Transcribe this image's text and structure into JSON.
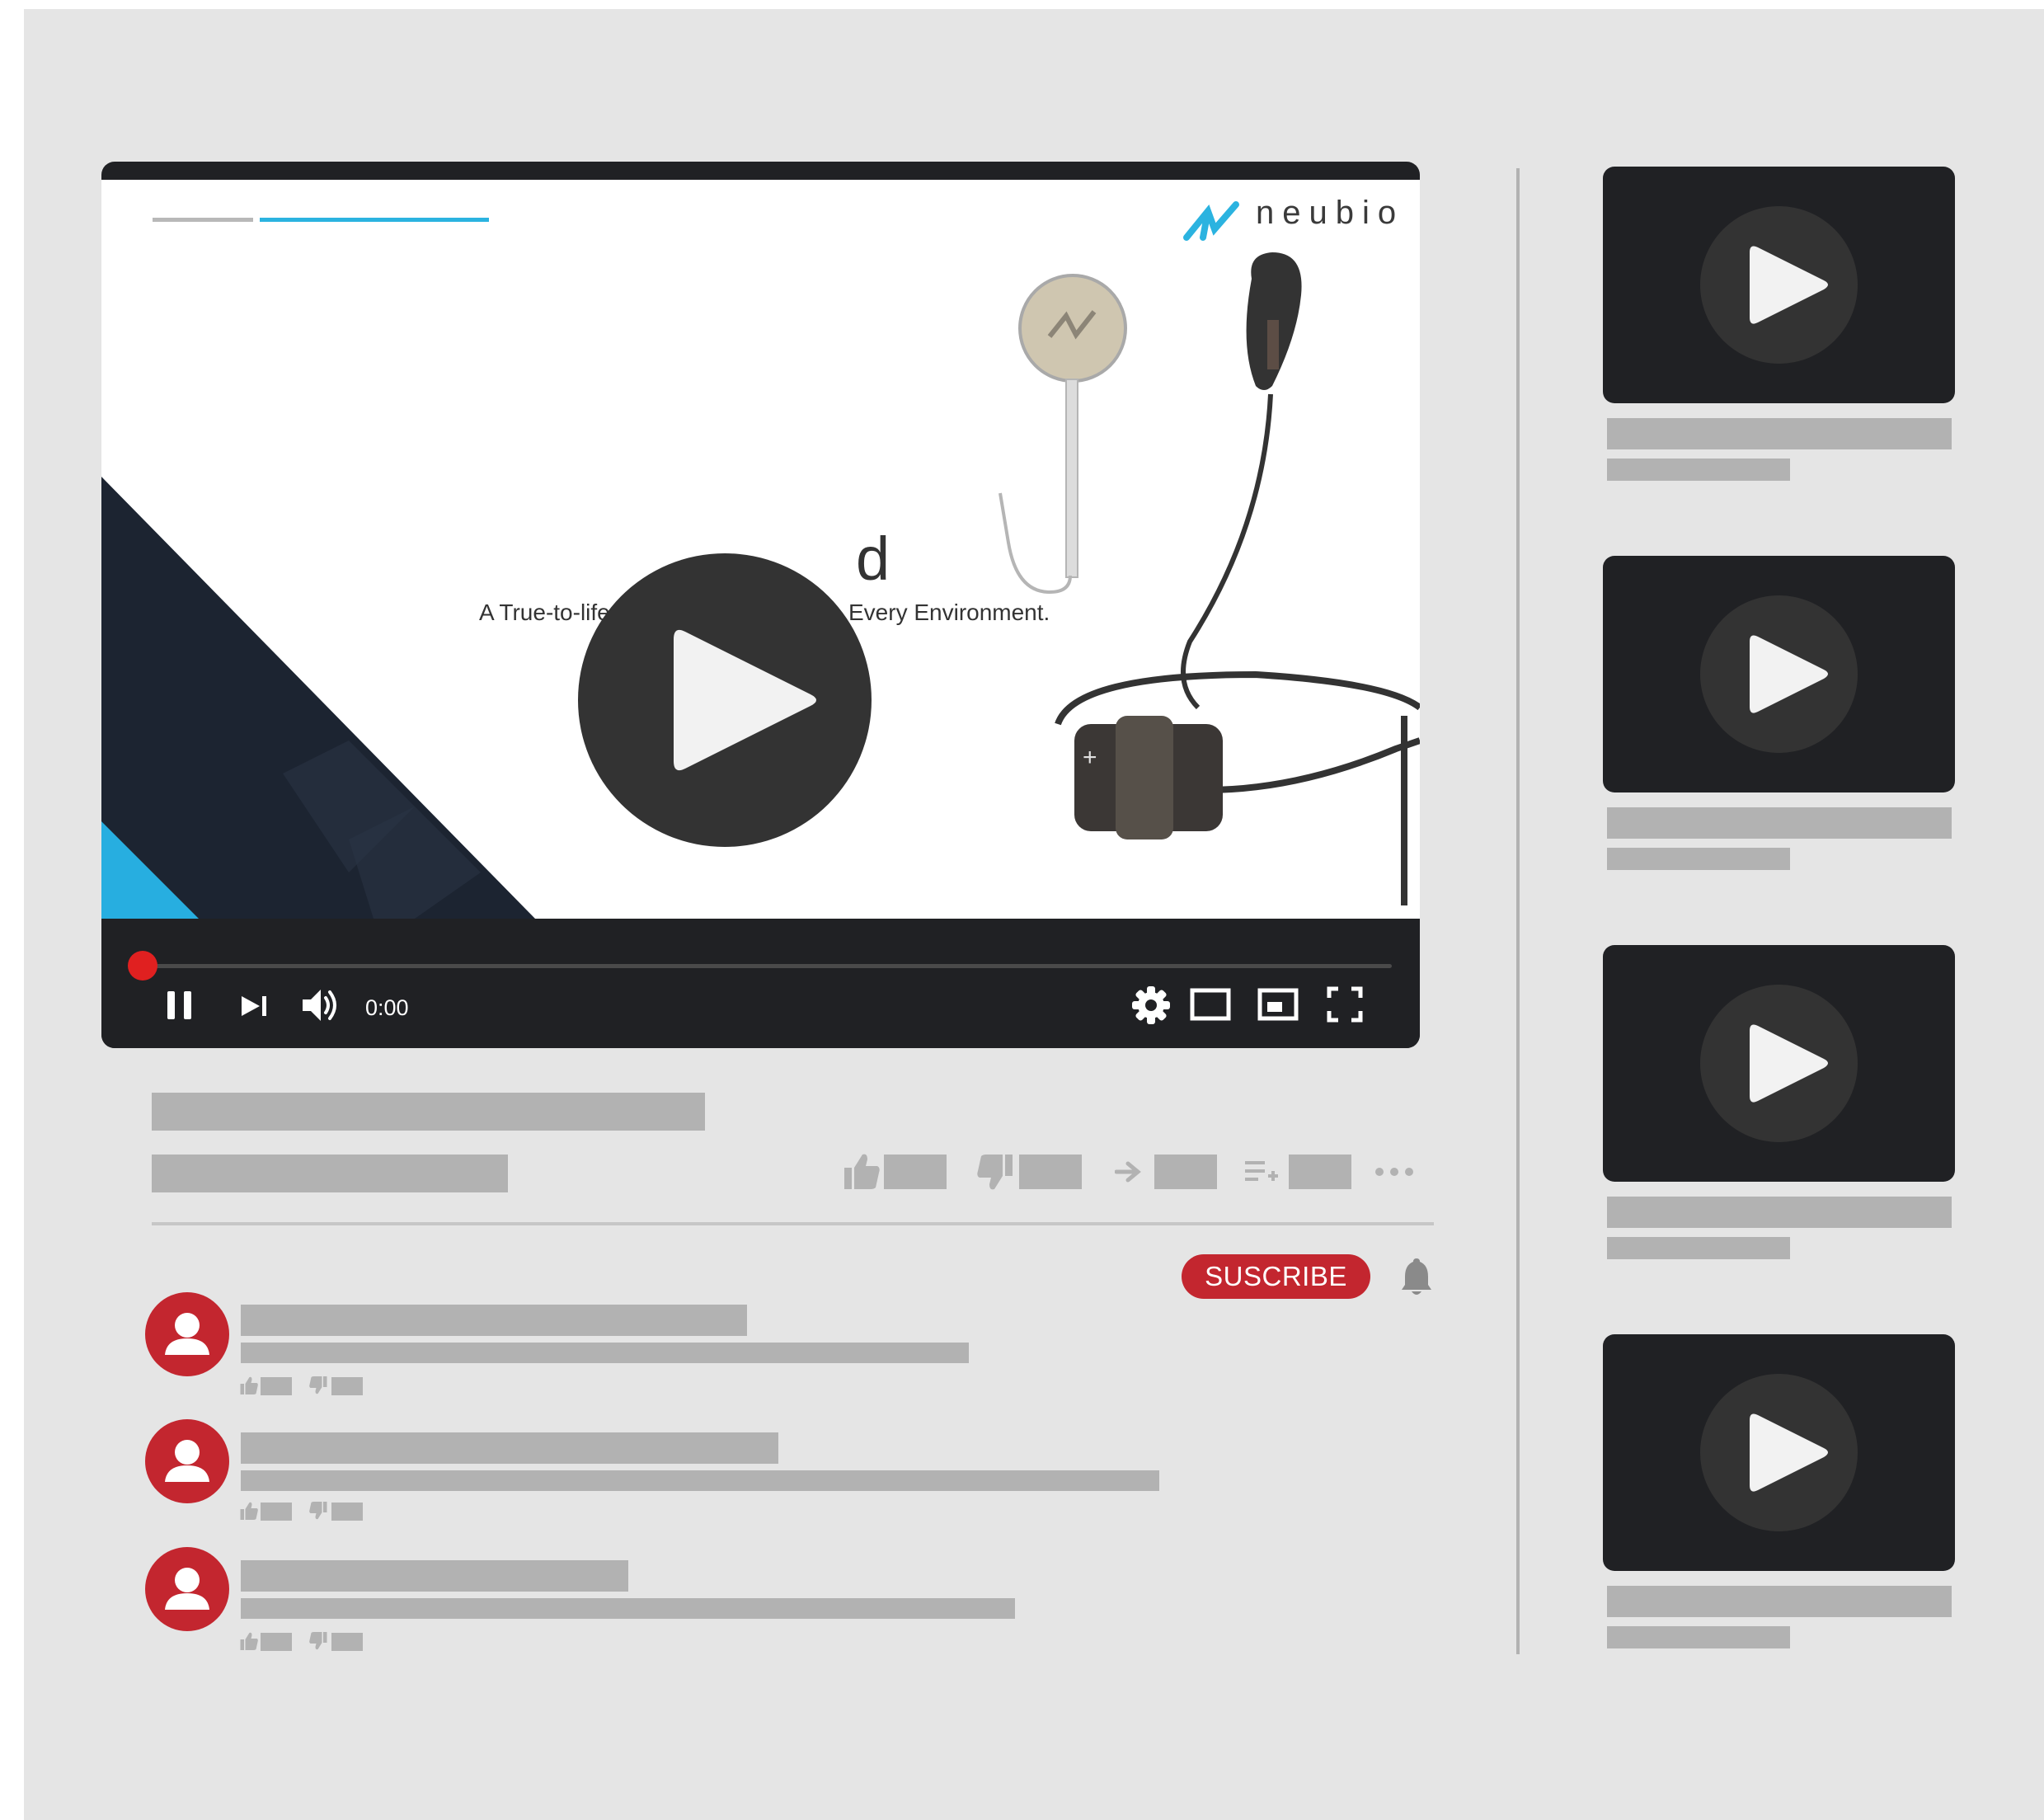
{
  "player": {
    "brand": "neubio",
    "slide_subtitle_left": "A True-to-life",
    "slide_subtitle_right": "Every Environment.",
    "slide_title_fragment": "d",
    "time": "0:00",
    "progress": 0
  },
  "channel": {
    "subscribe_label": "SUSCRIBE"
  },
  "icons": {
    "play": "play-icon",
    "pause": "pause-icon",
    "next": "next-icon",
    "volume": "volume-icon",
    "settings": "gear-icon",
    "theater": "theater-mode-icon",
    "miniplayer": "miniplayer-icon",
    "fullscreen": "fullscreen-icon",
    "like": "thumbs-up-icon",
    "dislike": "thumbs-down-icon",
    "share": "share-arrow-icon",
    "save": "add-to-playlist-icon",
    "more": "more-icon",
    "bell": "bell-icon",
    "user": "user-icon"
  },
  "colors": {
    "accent_red": "#c3262f",
    "brand_blue": "#2bb3e0",
    "player_dark": "#202124",
    "placeholder_gray": "#b2b2b2",
    "background": "#e5e5e5"
  }
}
